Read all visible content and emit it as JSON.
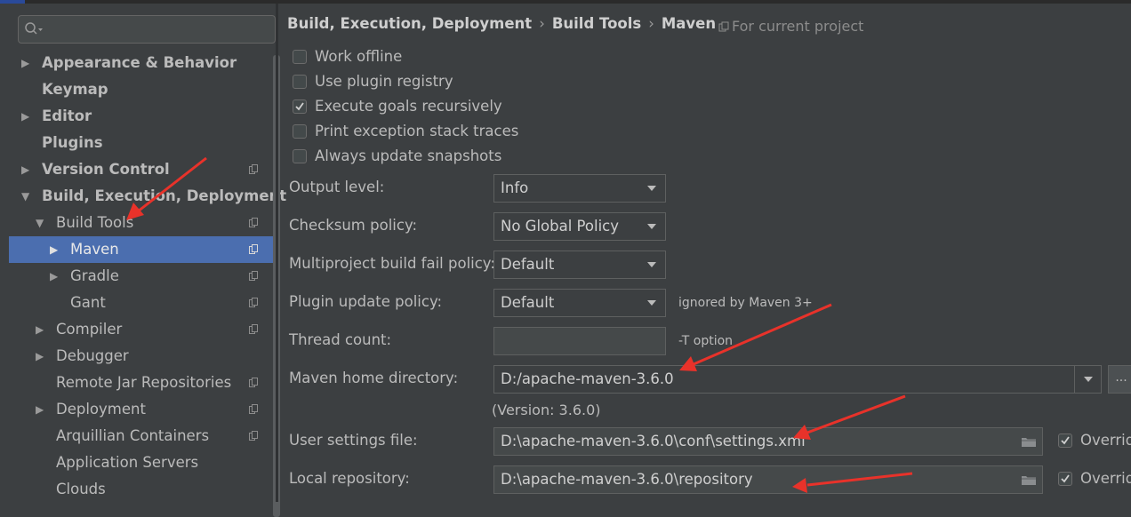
{
  "search": {
    "placeholder": ""
  },
  "tree": [
    {
      "label": "Appearance & Behavior",
      "level": 0,
      "bold": true,
      "arrow": "right",
      "copy": false
    },
    {
      "label": "Keymap",
      "level": 0,
      "bold": true,
      "arrow": "none",
      "copy": false
    },
    {
      "label": "Editor",
      "level": 0,
      "bold": true,
      "arrow": "right",
      "copy": false
    },
    {
      "label": "Plugins",
      "level": 0,
      "bold": true,
      "arrow": "none",
      "copy": false
    },
    {
      "label": "Version Control",
      "level": 0,
      "bold": true,
      "arrow": "right",
      "copy": true
    },
    {
      "label": "Build, Execution, Deployment",
      "level": 0,
      "bold": true,
      "arrow": "down",
      "copy": false
    },
    {
      "label": "Build Tools",
      "level": 1,
      "bold": false,
      "arrow": "down",
      "copy": true
    },
    {
      "label": "Maven",
      "level": 2,
      "bold": false,
      "arrow": "right",
      "copy": true,
      "selected": true
    },
    {
      "label": "Gradle",
      "level": 2,
      "bold": false,
      "arrow": "right",
      "copy": true
    },
    {
      "label": "Gant",
      "level": 2,
      "bold": false,
      "arrow": "none",
      "copy": true
    },
    {
      "label": "Compiler",
      "level": 1,
      "bold": false,
      "arrow": "right",
      "copy": true
    },
    {
      "label": "Debugger",
      "level": 1,
      "bold": false,
      "arrow": "right",
      "copy": false
    },
    {
      "label": "Remote Jar Repositories",
      "level": 1,
      "bold": false,
      "arrow": "none",
      "copy": true
    },
    {
      "label": "Deployment",
      "level": 1,
      "bold": false,
      "arrow": "right",
      "copy": true
    },
    {
      "label": "Arquillian Containers",
      "level": 1,
      "bold": false,
      "arrow": "none",
      "copy": true
    },
    {
      "label": "Application Servers",
      "level": 1,
      "bold": false,
      "arrow": "none",
      "copy": false
    },
    {
      "label": "Clouds",
      "level": 1,
      "bold": false,
      "arrow": "none",
      "copy": false
    }
  ],
  "breadcrumb": [
    "Build, Execution, Deployment",
    "Build Tools",
    "Maven"
  ],
  "breadcrumb_sep": "›",
  "scope": "For current project",
  "checkboxes": [
    {
      "label": "Work offline",
      "checked": false
    },
    {
      "label": "Use plugin registry",
      "checked": false
    },
    {
      "label": "Execute goals recursively",
      "checked": true
    },
    {
      "label": "Print exception stack traces",
      "checked": false
    },
    {
      "label": "Always update snapshots",
      "checked": false
    }
  ],
  "fields": {
    "output_level": {
      "label": "Output level:",
      "value": "Info"
    },
    "checksum_policy": {
      "label": "Checksum policy:",
      "value": "No Global Policy"
    },
    "fail_policy": {
      "label": "Multiproject build fail policy:",
      "value": "Default"
    },
    "plugin_update": {
      "label": "Plugin update policy:",
      "value": "Default",
      "hint": "ignored by Maven 3+"
    },
    "thread_count": {
      "label": "Thread count:",
      "value": "",
      "hint": "-T option"
    },
    "maven_home": {
      "label": "Maven home directory:",
      "value": "D:/apache-maven-3.6.0",
      "browse": "..."
    },
    "version": "(Version: 3.6.0)",
    "user_settings": {
      "label": "User settings file:",
      "value": "D:\\apache-maven-3.6.0\\conf\\settings.xml",
      "override": "Overrid",
      "override_checked": true
    },
    "local_repo": {
      "label": "Local repository:",
      "value": "D:\\apache-maven-3.6.0\\repository",
      "override": "Overrid",
      "override_checked": true
    }
  },
  "colors": {
    "background": "#3c3f41",
    "selection": "#4b6eaf",
    "annotation_arrow": "#e8322a"
  }
}
